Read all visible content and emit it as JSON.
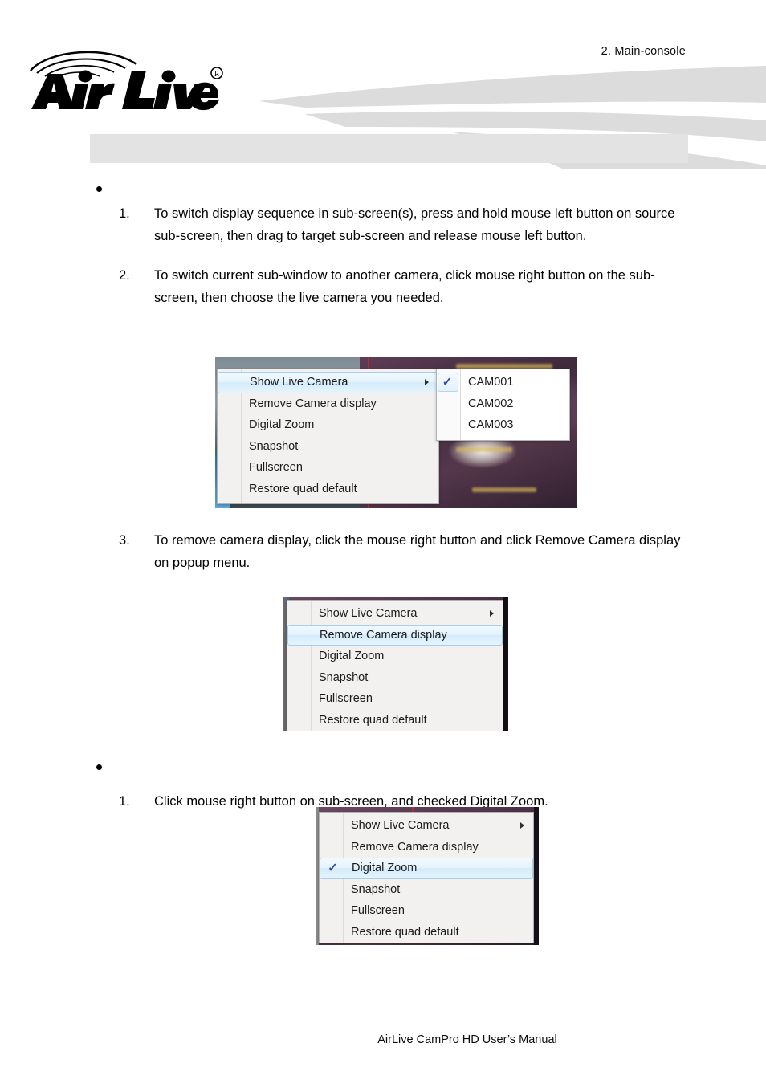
{
  "header": {
    "chapter": "2.  Main-console",
    "logo_text": "Air Live",
    "logo_mark": "registered-trademark",
    "band_text": ""
  },
  "content": {
    "bullet_1": "",
    "items_group_1": [
      {
        "num": "1.",
        "text": "To switch display sequence in sub-screen(s), press and hold mouse left button on source sub-screen, then drag to target sub-screen and release mouse left button."
      },
      {
        "num": "2.",
        "text": "To switch current sub-window to another camera, click mouse right button on the sub-screen, then choose the live camera you needed."
      },
      {
        "num": "3.",
        "text": "To remove camera display, click the mouse right button and click Remove Camera display on popup menu."
      }
    ],
    "bullet_2": "",
    "items_group_2": [
      {
        "num": "1.",
        "text": "Click mouse right button on sub-screen, and checked Digital Zoom."
      }
    ]
  },
  "figures": {
    "figure_1": {
      "menu_items": [
        {
          "label": "Show Live Camera",
          "has_submenu": true,
          "highlighted": true,
          "checked": false
        },
        {
          "label": "Remove Camera display",
          "has_submenu": false,
          "highlighted": false,
          "checked": false
        },
        {
          "label": "Digital Zoom",
          "has_submenu": false,
          "highlighted": false,
          "checked": false
        },
        {
          "label": "Snapshot",
          "has_submenu": false,
          "highlighted": false,
          "checked": false
        },
        {
          "label": "Fullscreen",
          "has_submenu": false,
          "highlighted": false,
          "checked": false
        },
        {
          "label": "Restore quad default",
          "has_submenu": false,
          "highlighted": false,
          "checked": false
        }
      ],
      "submenu_items": [
        {
          "label": "CAM001",
          "checked": true
        },
        {
          "label": "CAM002",
          "checked": false
        },
        {
          "label": "CAM003",
          "checked": false
        }
      ]
    },
    "figure_2": {
      "menu_items": [
        {
          "label": "Show Live Camera",
          "has_submenu": true,
          "highlighted": false,
          "checked": false
        },
        {
          "label": "Remove Camera display",
          "has_submenu": false,
          "highlighted": true,
          "checked": false
        },
        {
          "label": "Digital Zoom",
          "has_submenu": false,
          "highlighted": false,
          "checked": false
        },
        {
          "label": "Snapshot",
          "has_submenu": false,
          "highlighted": false,
          "checked": false
        },
        {
          "label": "Fullscreen",
          "has_submenu": false,
          "highlighted": false,
          "checked": false
        },
        {
          "label": "Restore quad default",
          "has_submenu": false,
          "highlighted": false,
          "checked": false
        }
      ]
    },
    "figure_3": {
      "menu_items": [
        {
          "label": "Show Live Camera",
          "has_submenu": true,
          "highlighted": false,
          "checked": false
        },
        {
          "label": "Remove Camera display",
          "has_submenu": false,
          "highlighted": false,
          "checked": false
        },
        {
          "label": "Digital Zoom",
          "has_submenu": false,
          "highlighted": true,
          "checked": true
        },
        {
          "label": "Snapshot",
          "has_submenu": false,
          "highlighted": false,
          "checked": false
        },
        {
          "label": "Fullscreen",
          "has_submenu": false,
          "highlighted": false,
          "checked": false
        },
        {
          "label": "Restore quad default",
          "has_submenu": false,
          "highlighted": false,
          "checked": false
        }
      ]
    },
    "check_glyph": "✓"
  },
  "footer": {
    "text": "AirLive CamPro HD User’s Manual"
  },
  "colors": {
    "band": "#e3e3e3",
    "swoosh": "#dcdcdc",
    "menu_bg": "#f2f1f0",
    "highlight": "#d4ebfb",
    "check": "#2b4fa8"
  }
}
